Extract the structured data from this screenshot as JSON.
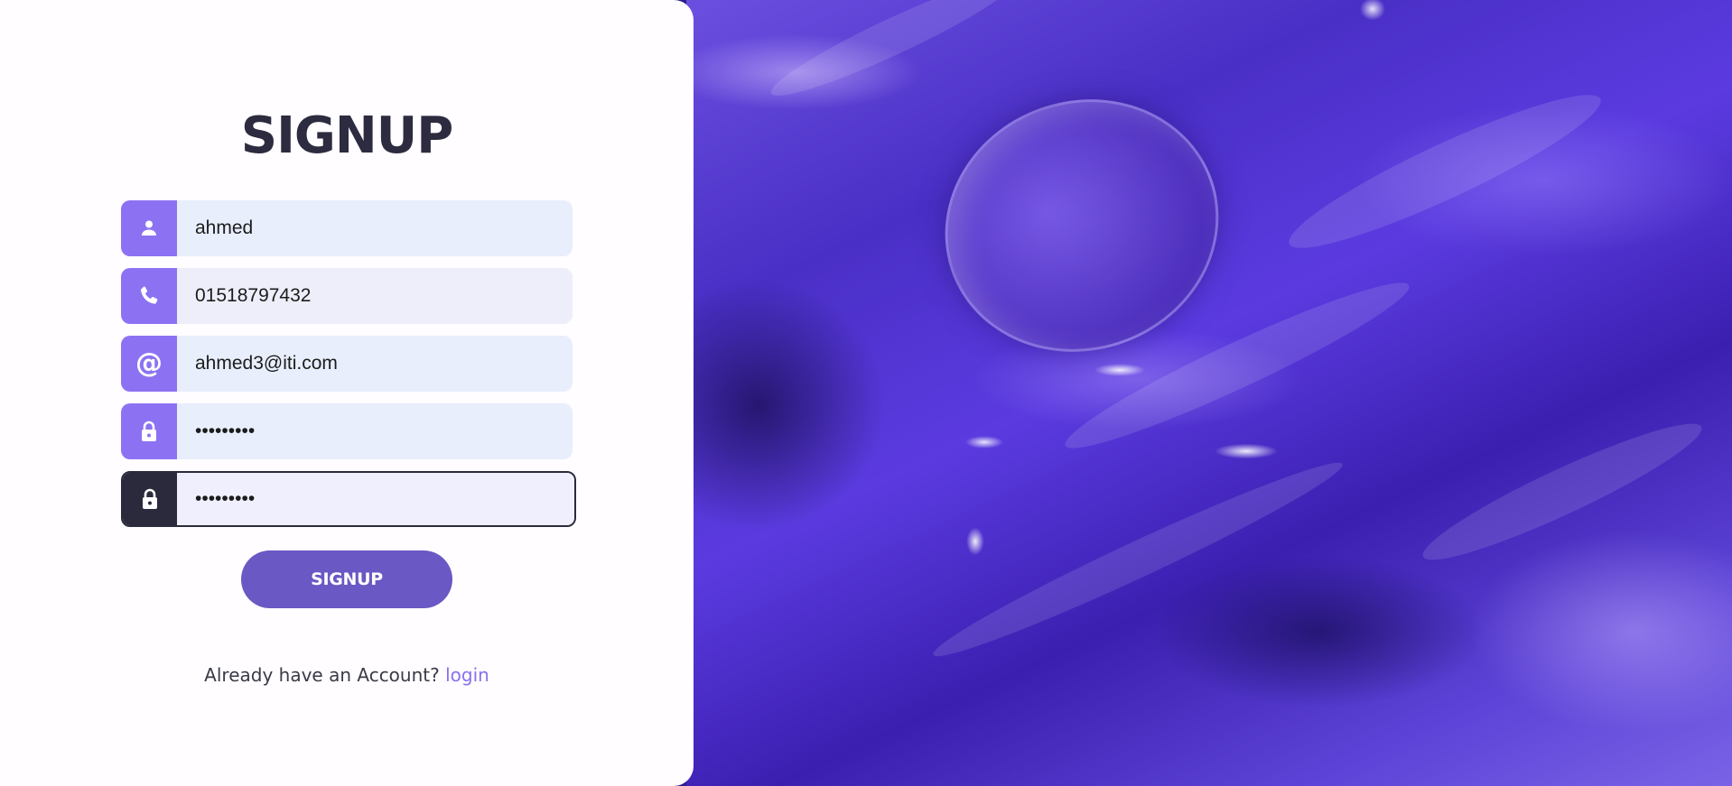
{
  "form": {
    "title": "SIGNUP",
    "fields": [
      {
        "name": "username",
        "value": "ahmed",
        "icon": "user-icon",
        "type": "text"
      },
      {
        "name": "phone",
        "value": "01518797432",
        "icon": "phone-icon",
        "type": "text"
      },
      {
        "name": "email",
        "value": "ahmed3@iti.com",
        "icon": "at-icon",
        "type": "text"
      },
      {
        "name": "password",
        "value": "123456789",
        "icon": "lock-icon",
        "type": "password"
      },
      {
        "name": "confirm-password",
        "value": "123456789",
        "icon": "lock-icon",
        "type": "password"
      }
    ],
    "submit_label": "SIGNUP"
  },
  "footer": {
    "prompt": "Already have an Account? ",
    "login_label": "login"
  },
  "colors": {
    "accent": "#8c72f3",
    "button": "#6a58c4",
    "title": "#2c2b3f",
    "focused_icon_bg": "#2b2a3c",
    "link": "#8a6ff0"
  }
}
